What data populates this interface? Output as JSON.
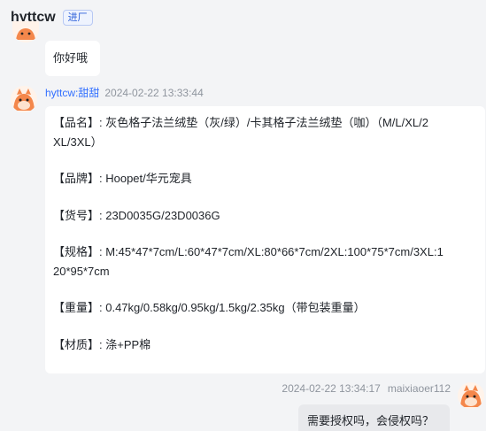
{
  "header": {
    "title": "hyttcw",
    "tag": "进厂"
  },
  "messages": [
    {
      "text": "你好哦"
    },
    {
      "sender": "hyttcw:甜甜",
      "time": "2024-02-22 13:33:44",
      "lines": [
        "【品名】: 灰色格子法兰绒垫（灰/绿）/卡其格子法兰绒垫（咖）（M/L/XL/2",
        "XL/3XL）",
        "【品牌】: Hoopet/华元宠具",
        "【货号】: 23D0035G/23D0036G",
        "【规格】: M:45*47*7cm/L:60*47*7cm/XL:80*66*7cm/2XL:100*75*7cm/3XL:1",
        "20*95*7cm",
        "【重量】: 0.47kg/0.58kg/0.95kg/1.5kg/2.35kg（带包装重量）",
        "【材质】: 涤+PP棉"
      ]
    },
    {
      "sender": "maixiaoer112",
      "time": "2024-02-22 13:34:17",
      "text": "需要授权吗，会侵权吗？"
    }
  ],
  "colors": {
    "background": "#f3f4f6",
    "bubble": "#ffffff",
    "my_bubble": "#e8e9ec",
    "name": "#3370ff",
    "meta": "#8f959e",
    "avatar": "#f4874b"
  }
}
